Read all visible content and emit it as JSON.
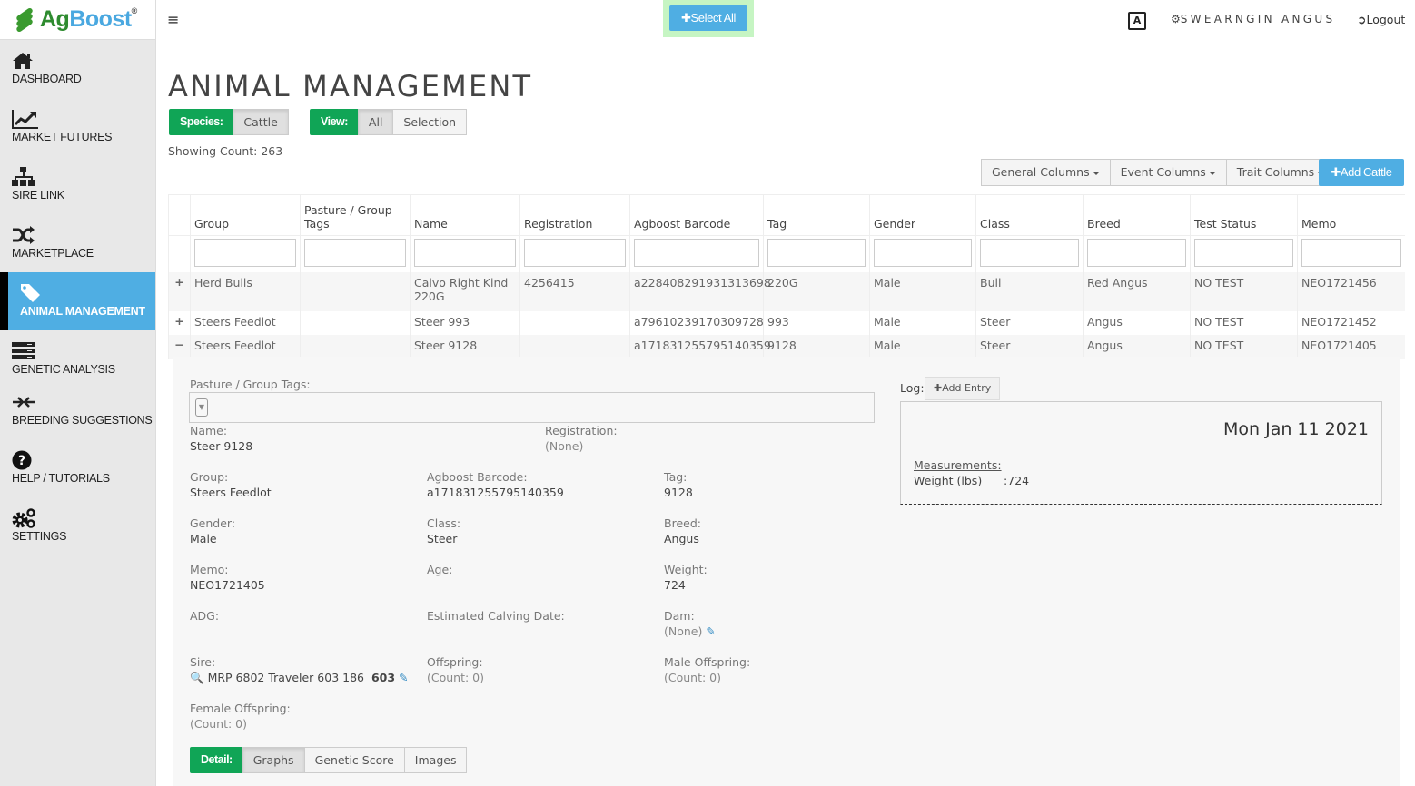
{
  "brand": {
    "ag": "Ag",
    "boost": "Boost",
    "reg": "®"
  },
  "sidebar": {
    "items": [
      {
        "label": "DASHBOARD",
        "icon": "home-icon"
      },
      {
        "label": "MARKET FUTURES",
        "icon": "line-chart-icon"
      },
      {
        "label": "SIRE LINK",
        "icon": "sitemap-icon"
      },
      {
        "label": "MARKETPLACE",
        "icon": "shuffle-icon"
      },
      {
        "label": "ANIMAL MANAGEMENT",
        "icon": "tag-icon",
        "active": true
      },
      {
        "label": "GENETIC ANALYSIS",
        "icon": "server-icon"
      },
      {
        "label": "BREEDING SUGGESTIONS",
        "icon": "compress-arrows-icon"
      },
      {
        "label": "HELP / TUTORIALS",
        "icon": "question-circle-icon"
      },
      {
        "label": "SETTINGS",
        "icon": "gears-icon"
      }
    ]
  },
  "topbar": {
    "select_all": "Select All",
    "user_name": "SWEARNGIN ANGUS",
    "logout": "Logout",
    "lang_glyph": "A"
  },
  "page": {
    "title": "ANIMAL MANAGEMENT",
    "species_label": "Species:",
    "species_value": "Cattle",
    "view_label": "View:",
    "view_options": [
      "All",
      "Selection"
    ],
    "view_selected": "All",
    "showing_count": "Showing Count: 263",
    "columns_menus": [
      "General Columns",
      "Event Columns",
      "Trait Columns"
    ],
    "add_button": "Add Cattle"
  },
  "table": {
    "headers": [
      "Group",
      "Pasture / Group Tags",
      "Name",
      "Registration",
      "Agboost Barcode",
      "Tag",
      "Gender",
      "Class",
      "Breed",
      "Test Status",
      "Memo"
    ],
    "rows": [
      {
        "toggle": "+",
        "cells": [
          "Herd Bulls",
          "",
          "Calvo Right Kind 220G",
          "4256415",
          "a228408291931313698",
          "220G",
          "Male",
          "Bull",
          "Red Angus",
          "NO TEST",
          "NEO1721456"
        ]
      },
      {
        "toggle": "+",
        "cells": [
          "Steers Feedlot",
          "",
          "Steer 993",
          "",
          "a79610239170309728",
          "993",
          "Male",
          "Steer",
          "Angus",
          "NO TEST",
          "NEO1721452"
        ]
      },
      {
        "toggle": "−",
        "cells": [
          "Steers Feedlot",
          "",
          "Steer 9128",
          "",
          "a171831255795140359",
          "9128",
          "Male",
          "Steer",
          "Angus",
          "NO TEST",
          "NEO1721405"
        ]
      }
    ]
  },
  "detail": {
    "tags_label": "Pasture / Group Tags:",
    "name": {
      "label": "Name:",
      "value": "Steer 9128"
    },
    "registration": {
      "label": "Registration:",
      "value": "(None)"
    },
    "group": {
      "label": "Group:",
      "value": "Steers Feedlot"
    },
    "barcode": {
      "label": "Agboost Barcode:",
      "value": "a171831255795140359"
    },
    "tag": {
      "label": "Tag:",
      "value": "9128"
    },
    "gender": {
      "label": "Gender:",
      "value": "Male"
    },
    "class": {
      "label": "Class:",
      "value": "Steer"
    },
    "breed": {
      "label": "Breed:",
      "value": "Angus"
    },
    "memo": {
      "label": "Memo:",
      "value": "NEO1721405"
    },
    "age": {
      "label": "Age:",
      "value": ""
    },
    "weight": {
      "label": "Weight:",
      "value": "724"
    },
    "adg": {
      "label": "ADG:",
      "value": ""
    },
    "calving": {
      "label": "Estimated Calving Date:",
      "value": ""
    },
    "dam": {
      "label": "Dam:",
      "value": "(None)"
    },
    "sire": {
      "label": "Sire:",
      "value": "MRP 6802 Traveler 603 186",
      "tag": "603"
    },
    "offspring": {
      "label": "Offspring:",
      "value": "(Count: 0)"
    },
    "male_offspring": {
      "label": "Male Offspring:",
      "value": "(Count: 0)"
    },
    "female_offspring": {
      "label": "Female Offspring:",
      "value": "(Count: 0)"
    },
    "log": {
      "label": "Log:",
      "add_entry": "Add Entry",
      "date": "Mon Jan 11 2021",
      "measurements_label": "Measurements:",
      "weight_label": "Weight (lbs)",
      "weight_value": ":724"
    },
    "tabs": {
      "label": "Detail:",
      "items": [
        "Graphs",
        "Genetic Score",
        "Images"
      ],
      "selected": "Graphs"
    }
  },
  "colors": {
    "green": "#10a556",
    "blue": "#4faee3",
    "select_all_bg": "#c6f5c3",
    "sidebar_bg": "#e8e8e8"
  }
}
